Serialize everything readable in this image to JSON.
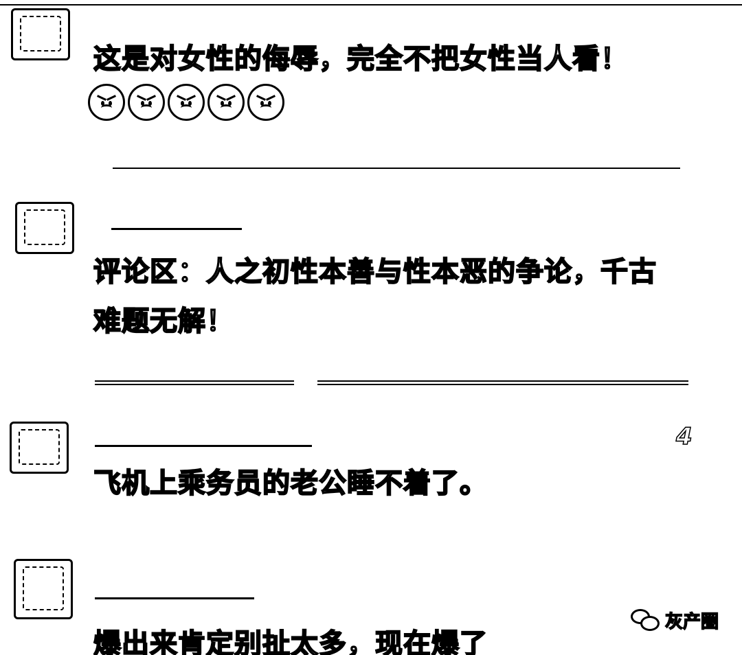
{
  "comments": [
    {
      "text": "这是对女性的侮辱，完全不把女性当人看！",
      "reaction": "angry-face-icon"
    },
    {
      "text_line1": "评论区：人之初性本善与性本恶的争论，千古",
      "text_line2": "难题无解！"
    },
    {
      "count": "4",
      "text": "飞机上乘务员的老公睡不着了。"
    },
    {
      "text": "爆出来肯定别扯太多，现在爆了"
    }
  ],
  "watermark": {
    "label": "灰产圈",
    "icon": "wechat-icon"
  }
}
